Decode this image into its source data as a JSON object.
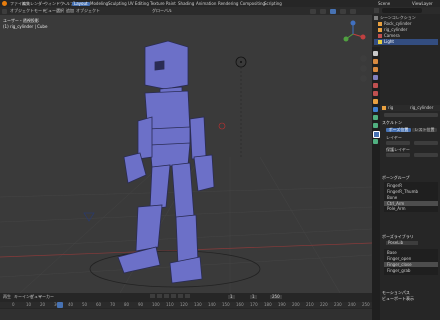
{
  "topbar": {
    "menus": [
      "ファイル",
      "編集",
      "レンダー",
      "ウィンドウ",
      "ヘルプ"
    ],
    "workspaces": [
      "Layout",
      "Modeling",
      "Sculpting",
      "UV Editing",
      "Texture Paint",
      "Shading",
      "Animation",
      "Rendering",
      "Compositing",
      "Scripting"
    ],
    "active_workspace": "Layout",
    "scene": "Scene",
    "view_layer": "ViewLayer"
  },
  "viewport": {
    "mode": "オブジェクトモード",
    "menus": [
      "ビュー",
      "選択",
      "追加",
      "オブジェクト"
    ],
    "orientation": "グローバル",
    "overlay_line1": "ユーザー・透視投影",
    "overlay_line2": "(1) rig_cylinder | Cube",
    "accent_color": "#4772b3",
    "model_color": "#6c70c8"
  },
  "timeline": {
    "menus": [
      "再生",
      "キーイング",
      "ビュー",
      "マーカー"
    ],
    "current_frame": "1",
    "start": "1",
    "end": "250",
    "ticks": [
      "0",
      "10",
      "20",
      "30",
      "40",
      "50",
      "60",
      "70",
      "80",
      "90",
      "100",
      "110",
      "120",
      "130",
      "140",
      "150",
      "160",
      "170",
      "180",
      "190",
      "200",
      "210",
      "220",
      "230",
      "240",
      "250"
    ]
  },
  "outliner": {
    "items": [
      {
        "label": "シーンコレクション",
        "icon": "scene-collection-icon"
      },
      {
        "label": "Rock_cylinder",
        "icon": "armature-icon"
      },
      {
        "label": "rig_cylinder",
        "icon": "armature-icon"
      },
      {
        "label": "Camera",
        "icon": "camera-icon"
      },
      {
        "label": "Light",
        "icon": "light-icon"
      }
    ]
  },
  "properties": {
    "object_name": "rig_cylinder",
    "sub_name": "rig",
    "sections": {
      "skeleton": "スケルトン",
      "pose_position": "ポーズ位置",
      "rest_position": "レスト位置",
      "layers": "レイヤー",
      "protected_layers": "保護レイヤー",
      "bone_groups": "ボーングループ",
      "pose_library": "ポーズライブラリ",
      "motion_paths": "モーションパス",
      "viewport_display": "ビューポート表示"
    },
    "bone_groups": [
      "FingerR",
      "FingerR_Thumb",
      "Bone",
      "Ctrl_Arm",
      "Pole_Arm"
    ],
    "pose_library_name": "PoseLib",
    "poses": [
      "Base",
      "Finger_open",
      "Finger_close",
      "Finger_grab"
    ],
    "active_pose_index": 2
  }
}
